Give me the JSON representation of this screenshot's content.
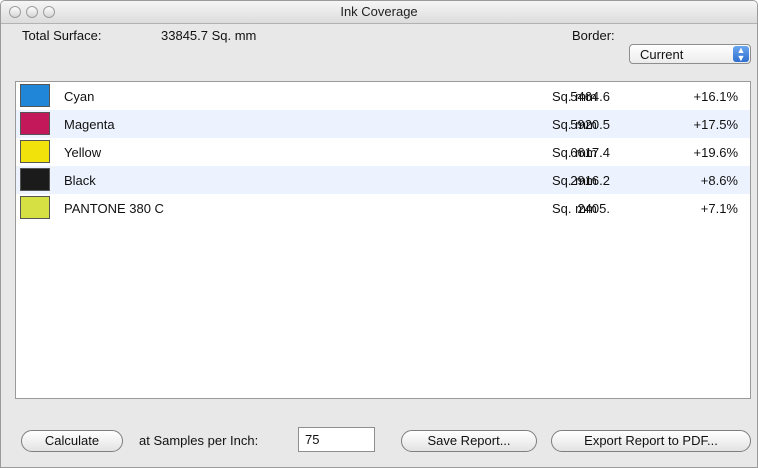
{
  "window": {
    "title": "Ink Coverage"
  },
  "header": {
    "total_surface_label": "Total Surface:",
    "total_surface_value": "33845.7 Sq. mm",
    "border_label": "Border:",
    "border_select_value": "Current"
  },
  "inks": [
    {
      "name": "Cyan",
      "value": "5464.6",
      "unit": "Sq. mm",
      "percent": "+16.1%",
      "color": "#1f86d8"
    },
    {
      "name": "Magenta",
      "value": "5920.5",
      "unit": "Sq. mm",
      "percent": "+17.5%",
      "color": "#c3185a"
    },
    {
      "name": "Yellow",
      "value": "6617.4",
      "unit": "Sq. mm",
      "percent": "+19.6%",
      "color": "#f2e20b"
    },
    {
      "name": "Black",
      "value": "2916.2",
      "unit": "Sq. mm",
      "percent": "+8.6%",
      "color": "#1b1b1b"
    },
    {
      "name": "PANTONE 380 C",
      "value": "2405.",
      "unit": "Sq. mm",
      "percent": "+7.1%",
      "color": "#d6e043"
    }
  ],
  "footer": {
    "calculate_label": "Calculate",
    "samples_label": "at Samples per Inch:",
    "samples_value": "75",
    "save_report_label": "Save Report...",
    "export_pdf_label": "Export Report to PDF..."
  }
}
